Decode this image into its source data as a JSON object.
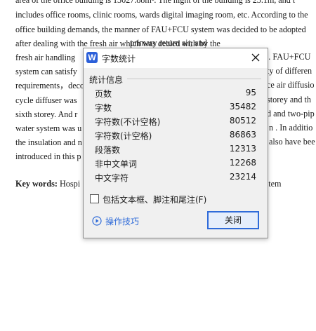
{
  "document": {
    "lines": [
      "area of the office building is 13027.88m². The hight of the building is 23.1m, and t",
      "includes office rooms, clinic rooms, wards digital imaging room, etc. According to the",
      "office building demands, the manner of   FAU+FCU system was decided to be adopted",
      "after dealing with the fresh air which was dealed with by the",
      "fresh air handling",
      "system can satisfy",
      "requirements，deco",
      "cycle diffuser was",
      "sixth storey. And r",
      "water system was u",
      "the insulation and n",
      "introduced in this p"
    ],
    "right_fragments": [
      "ms. FAU+FCU",
      "ty of differen",
      "ce air diffusio",
      "storey and th",
      "d and two-pip",
      "n . In additio",
      "also have bee"
    ],
    "inline_fragment": "primary return air, and",
    "keywords_label": "Key words:",
    "keywords_text": "Hospi",
    "keywords_tail": "tystem"
  },
  "dialog": {
    "app_icon": "W",
    "title": "字数统计",
    "group_label": "统计信息",
    "stats": [
      {
        "label": "页数",
        "value": "95"
      },
      {
        "label": "字数",
        "value": "35482"
      },
      {
        "label": "字符数(不计空格)",
        "value": "80512"
      },
      {
        "label": "字符数(计空格)",
        "value": "86863"
      },
      {
        "label": "段落数",
        "value": "12313"
      },
      {
        "label": "非中文单词",
        "value": "12268"
      },
      {
        "label": "中文字符",
        "value": "23214"
      }
    ],
    "checkbox_label": "包括文本框、脚注和尾注(F)",
    "checkbox_checked": false,
    "tips_link": "操作技巧",
    "close_button": "关闭",
    "accent_color": "#2f6bd9",
    "icons": {
      "close": "close-icon",
      "tips": "play-circle-icon",
      "app": "wps-writer-icon"
    }
  }
}
